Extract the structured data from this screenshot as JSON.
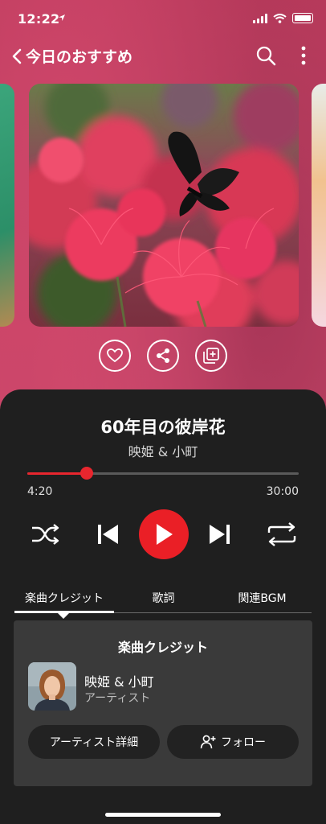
{
  "status": {
    "time": "12:22"
  },
  "header": {
    "title": "今日のおすすめ"
  },
  "song": {
    "title": "60年目の彼岸花",
    "artist": "映姫 & 小町"
  },
  "progress": {
    "elapsed": "4:20",
    "total": "30:00",
    "fraction": 0.22
  },
  "tabs": [
    {
      "label": "楽曲クレジット"
    },
    {
      "label": "歌詞"
    },
    {
      "label": "関連BGM"
    }
  ],
  "credits": {
    "title": "楽曲クレジット",
    "artist_name": "映姫 & 小町",
    "artist_role": "アーティスト",
    "detail_button": "アーティスト詳細",
    "follow_button": "フォロー"
  },
  "colors": {
    "accent": "#e8262e",
    "panel": "#1f1f1f",
    "card": "#3a3a3a"
  }
}
